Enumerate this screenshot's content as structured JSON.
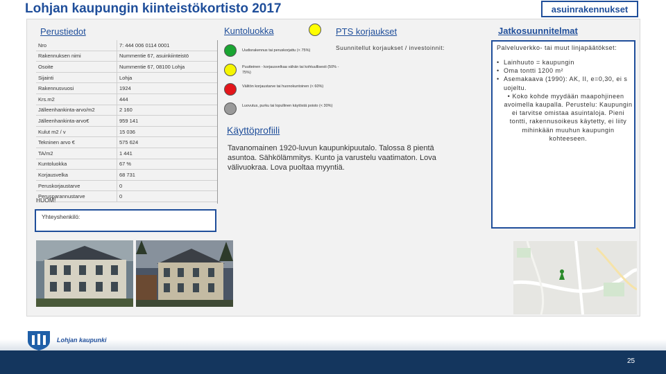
{
  "header": {
    "title": "Lohjan kaupungin kiinteistökortisto 2017",
    "badge": "asuinrakennukset"
  },
  "sections": {
    "perustiedot": "Perustiedot",
    "kuntoluokka": "Kuntoluokka",
    "pts": "PTS korjaukset",
    "jatko": "Jatkosuunnitelmat",
    "kaytto": "Käyttöprofiili"
  },
  "perustiedot": [
    {
      "label": "Nro",
      "value": "7: 444 006 0114 0001"
    },
    {
      "label": "Rakennuksen nimi",
      "value": "Nummentie 67, asuinkiinteistö"
    },
    {
      "label": "Osoite",
      "value": "Nummentie 67, 08100 Lohja"
    },
    {
      "label": "Sijainti",
      "value": "Lohja"
    },
    {
      "label": "Rakennusvuosi",
      "value": "1924"
    },
    {
      "label": "Krs.m2",
      "value": "444"
    },
    {
      "label": "Jälleenhankinta-arvo/m2",
      "value": "2 160"
    },
    {
      "label": "Jälleenhankinta-arvo€",
      "value": "959 141"
    },
    {
      "label": "Kulut m2 / v",
      "value": "15 036"
    },
    {
      "label": "Tekninen arvo €",
      "value": "575 624"
    },
    {
      "label": "TA/m2",
      "value": "1 441"
    },
    {
      "label": "Kuntoluokka",
      "value": "67 %"
    },
    {
      "label": "Korjausvelka",
      "value": "68 731"
    },
    {
      "label": "Peruskorjaustarve",
      "value": "0"
    },
    {
      "label": "Perusparannustarve",
      "value": "0"
    }
  ],
  "condition_legend": [
    {
      "color": "#1aa532",
      "text": "Uudisrakennus tai peruskorjattu (< 75%)"
    },
    {
      "color": "#f5f500",
      "text": "Puutteinen - korjausvelkaa vähän tai kohtuullisesti (50% - 75%)"
    },
    {
      "color": "#e3151a",
      "text": "Välitön korjaustarve tai huonokuntoinen (< 60%)"
    },
    {
      "color": "#9a9a9a",
      "text": "Luovutus, purku tai lopullinen käytöstä poisto (< 30%)"
    }
  ],
  "current_condition_color": "#ffff00",
  "pts_text": "Suunnitellut korjaukset / investoinnit:",
  "kaytto_text": "Tavanomainen 1920-luvun kaupunkipuutalo. Talossa 8 pientä asuntoa. Sähkölämmitys. Kunto ja varustelu vaatimaton. Lova välivuokraa. Lova puoltaa myyntiä.",
  "jatko": {
    "intro": "Palveluverkko- tai muut linjapäätökset:",
    "bullets": [
      "Lainhuuto = kaupungin",
      "Oma tontti 1200 m²",
      "Asemakaava (1990): AK, II, e=0,30, ei s uojeltu.",
      "Koko kohde myydään maapohjineen avoimella kaupalla. Perustelu: Kaupungin ei tarvitse omistaa asuintaloja. Pieni tontti, rakennusoikeus käytetty, ei liity mihinkään muuhun kaupungin kohteeseen."
    ]
  },
  "huom": "HUOM!",
  "yhteys": "Yhteyshenkilö:",
  "footer": {
    "logo_text": "Lohjan kaupunki",
    "page_number": "25"
  },
  "colors": {
    "accent": "#1f4e9a",
    "footer": "#14365e"
  }
}
